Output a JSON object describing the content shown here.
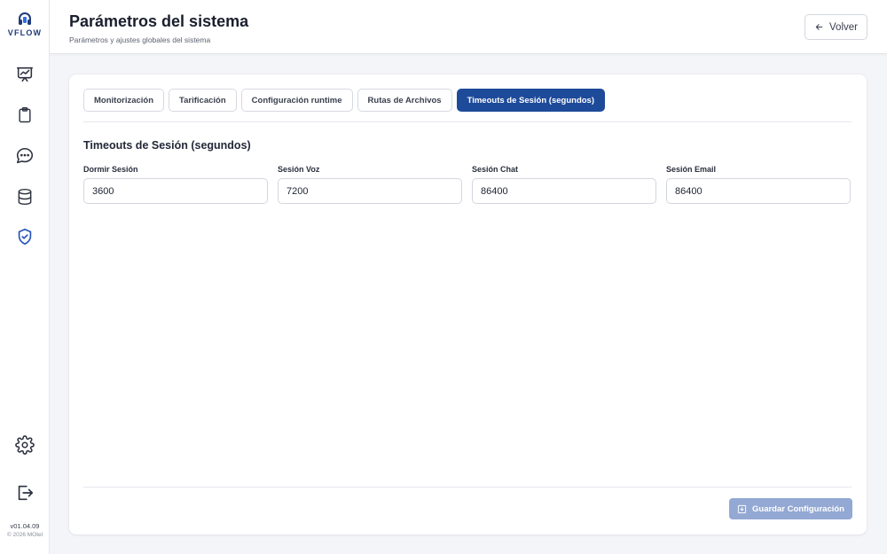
{
  "sidebar": {
    "logo_text": "VFLOW",
    "version": "v01.04.09",
    "copyright": "© 2026 MOtel",
    "items": [
      {
        "icon": "presentation-chart-icon"
      },
      {
        "icon": "clipboard-icon"
      },
      {
        "icon": "chat-bubble-icon"
      },
      {
        "icon": "database-icon"
      },
      {
        "icon": "shield-check-icon",
        "active": true
      }
    ],
    "bottom_items": [
      {
        "icon": "gear-icon"
      },
      {
        "icon": "logout-icon"
      }
    ]
  },
  "header": {
    "title": "Parámetros del sistema",
    "subtitle": "Parámetros y ajustes globales del sistema",
    "back_label": "Volver"
  },
  "tabs": [
    {
      "label": "Monitorización"
    },
    {
      "label": "Tarificación"
    },
    {
      "label": "Configuración runtime"
    },
    {
      "label": "Rutas de Archivos"
    },
    {
      "label": "Timeouts de Sesión (segundos)",
      "active": true
    }
  ],
  "section": {
    "title": "Timeouts de Sesión (segundos)",
    "fields": [
      {
        "label": "Dormir Sesión",
        "value": "3600"
      },
      {
        "label": "Sesión Voz",
        "value": "7200"
      },
      {
        "label": "Sesión Chat",
        "value": "86400"
      },
      {
        "label": "Sesión Email",
        "value": "86400"
      }
    ]
  },
  "footer": {
    "save_label": "Guardar Configuración"
  },
  "colors": {
    "primary": "#1e4a9a",
    "primary_disabled": "#93a8d3",
    "background": "#f4f5f8",
    "active_icon": "#2452b8"
  }
}
